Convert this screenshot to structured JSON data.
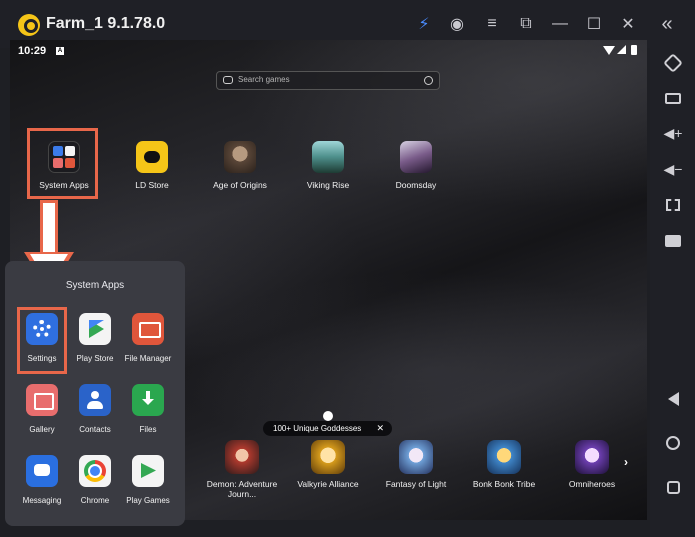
{
  "window": {
    "title": "Farm_1 9.1.78.0",
    "controls": [
      {
        "name": "bolt-icon",
        "glyph": "⚡",
        "color": "#4a8cff"
      },
      {
        "name": "account-icon",
        "glyph": "◉"
      },
      {
        "name": "menu-icon",
        "glyph": "≡"
      },
      {
        "name": "external-window-icon",
        "glyph": "⧉"
      },
      {
        "name": "minimize-icon",
        "glyph": "—"
      },
      {
        "name": "maximize-icon",
        "glyph": "☐"
      },
      {
        "name": "close-icon",
        "glyph": "✕"
      },
      {
        "name": "collapse-sidebar-icon",
        "glyph": "«"
      }
    ]
  },
  "status_bar": {
    "time": "10:29",
    "notification_icon": "A"
  },
  "search": {
    "placeholder": "Search games"
  },
  "desktop_apps": [
    {
      "name": "System Apps",
      "icon": "folder-icon"
    },
    {
      "name": "LD Store",
      "icon": "ld-store-icon"
    },
    {
      "name": "Age of Origins",
      "icon": "age-of-origins-icon"
    },
    {
      "name": "Viking Rise",
      "icon": "viking-rise-icon"
    },
    {
      "name": "Doomsday",
      "icon": "doomsday-icon"
    }
  ],
  "folder": {
    "title": "System Apps",
    "apps": [
      {
        "name": "Settings",
        "icon": "settings-icon"
      },
      {
        "name": "Play Store",
        "icon": "play-store-icon"
      },
      {
        "name": "File Manager",
        "icon": "file-manager-icon"
      },
      {
        "name": "Gallery",
        "icon": "gallery-icon"
      },
      {
        "name": "Contacts",
        "icon": "contacts-icon"
      },
      {
        "name": "Files",
        "icon": "files-icon"
      },
      {
        "name": "Messaging",
        "icon": "messaging-icon"
      },
      {
        "name": "Chrome",
        "icon": "chrome-icon"
      },
      {
        "name": "Play Games",
        "icon": "play-games-icon"
      }
    ]
  },
  "promo": {
    "banner": "100+ Unique Goddesses",
    "close_glyph": "✕"
  },
  "games_dock": [
    {
      "name": "Demon: Adventure Journ..."
    },
    {
      "name": "Valkyrie Alliance"
    },
    {
      "name": "Fantasy of Light"
    },
    {
      "name": "Bonk Bonk Tribe"
    },
    {
      "name": "Omniheroes"
    }
  ],
  "dock_next_glyph": "›",
  "highlight_color": "#e8674a"
}
